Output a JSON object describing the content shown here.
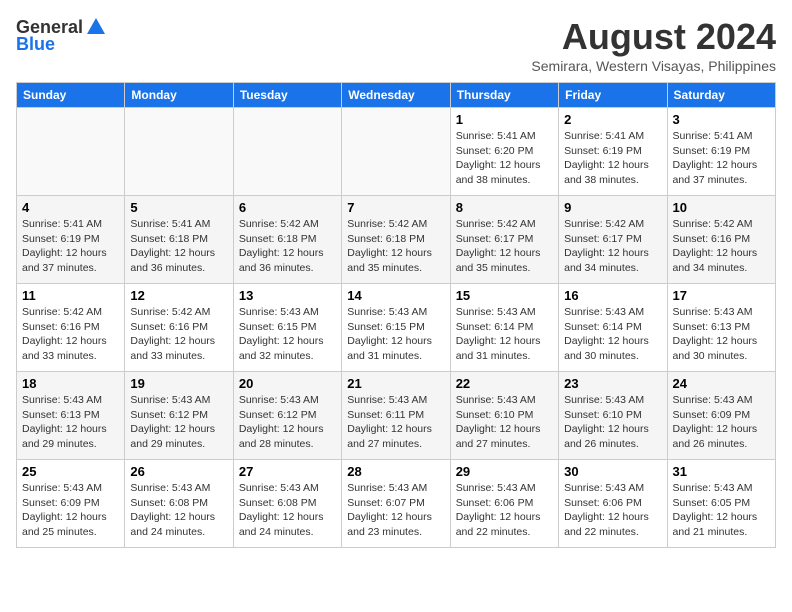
{
  "logo": {
    "general": "General",
    "blue": "Blue"
  },
  "title": {
    "month_year": "August 2024",
    "location": "Semirara, Western Visayas, Philippines"
  },
  "days_of_week": [
    "Sunday",
    "Monday",
    "Tuesday",
    "Wednesday",
    "Thursday",
    "Friday",
    "Saturday"
  ],
  "weeks": [
    [
      {
        "day": "",
        "content": ""
      },
      {
        "day": "",
        "content": ""
      },
      {
        "day": "",
        "content": ""
      },
      {
        "day": "",
        "content": ""
      },
      {
        "day": "1",
        "content": "Sunrise: 5:41 AM\nSunset: 6:20 PM\nDaylight: 12 hours\nand 38 minutes."
      },
      {
        "day": "2",
        "content": "Sunrise: 5:41 AM\nSunset: 6:19 PM\nDaylight: 12 hours\nand 38 minutes."
      },
      {
        "day": "3",
        "content": "Sunrise: 5:41 AM\nSunset: 6:19 PM\nDaylight: 12 hours\nand 37 minutes."
      }
    ],
    [
      {
        "day": "4",
        "content": "Sunrise: 5:41 AM\nSunset: 6:19 PM\nDaylight: 12 hours\nand 37 minutes."
      },
      {
        "day": "5",
        "content": "Sunrise: 5:41 AM\nSunset: 6:18 PM\nDaylight: 12 hours\nand 36 minutes."
      },
      {
        "day": "6",
        "content": "Sunrise: 5:42 AM\nSunset: 6:18 PM\nDaylight: 12 hours\nand 36 minutes."
      },
      {
        "day": "7",
        "content": "Sunrise: 5:42 AM\nSunset: 6:18 PM\nDaylight: 12 hours\nand 35 minutes."
      },
      {
        "day": "8",
        "content": "Sunrise: 5:42 AM\nSunset: 6:17 PM\nDaylight: 12 hours\nand 35 minutes."
      },
      {
        "day": "9",
        "content": "Sunrise: 5:42 AM\nSunset: 6:17 PM\nDaylight: 12 hours\nand 34 minutes."
      },
      {
        "day": "10",
        "content": "Sunrise: 5:42 AM\nSunset: 6:16 PM\nDaylight: 12 hours\nand 34 minutes."
      }
    ],
    [
      {
        "day": "11",
        "content": "Sunrise: 5:42 AM\nSunset: 6:16 PM\nDaylight: 12 hours\nand 33 minutes."
      },
      {
        "day": "12",
        "content": "Sunrise: 5:42 AM\nSunset: 6:16 PM\nDaylight: 12 hours\nand 33 minutes."
      },
      {
        "day": "13",
        "content": "Sunrise: 5:43 AM\nSunset: 6:15 PM\nDaylight: 12 hours\nand 32 minutes."
      },
      {
        "day": "14",
        "content": "Sunrise: 5:43 AM\nSunset: 6:15 PM\nDaylight: 12 hours\nand 31 minutes."
      },
      {
        "day": "15",
        "content": "Sunrise: 5:43 AM\nSunset: 6:14 PM\nDaylight: 12 hours\nand 31 minutes."
      },
      {
        "day": "16",
        "content": "Sunrise: 5:43 AM\nSunset: 6:14 PM\nDaylight: 12 hours\nand 30 minutes."
      },
      {
        "day": "17",
        "content": "Sunrise: 5:43 AM\nSunset: 6:13 PM\nDaylight: 12 hours\nand 30 minutes."
      }
    ],
    [
      {
        "day": "18",
        "content": "Sunrise: 5:43 AM\nSunset: 6:13 PM\nDaylight: 12 hours\nand 29 minutes."
      },
      {
        "day": "19",
        "content": "Sunrise: 5:43 AM\nSunset: 6:12 PM\nDaylight: 12 hours\nand 29 minutes."
      },
      {
        "day": "20",
        "content": "Sunrise: 5:43 AM\nSunset: 6:12 PM\nDaylight: 12 hours\nand 28 minutes."
      },
      {
        "day": "21",
        "content": "Sunrise: 5:43 AM\nSunset: 6:11 PM\nDaylight: 12 hours\nand 27 minutes."
      },
      {
        "day": "22",
        "content": "Sunrise: 5:43 AM\nSunset: 6:10 PM\nDaylight: 12 hours\nand 27 minutes."
      },
      {
        "day": "23",
        "content": "Sunrise: 5:43 AM\nSunset: 6:10 PM\nDaylight: 12 hours\nand 26 minutes."
      },
      {
        "day": "24",
        "content": "Sunrise: 5:43 AM\nSunset: 6:09 PM\nDaylight: 12 hours\nand 26 minutes."
      }
    ],
    [
      {
        "day": "25",
        "content": "Sunrise: 5:43 AM\nSunset: 6:09 PM\nDaylight: 12 hours\nand 25 minutes."
      },
      {
        "day": "26",
        "content": "Sunrise: 5:43 AM\nSunset: 6:08 PM\nDaylight: 12 hours\nand 24 minutes."
      },
      {
        "day": "27",
        "content": "Sunrise: 5:43 AM\nSunset: 6:08 PM\nDaylight: 12 hours\nand 24 minutes."
      },
      {
        "day": "28",
        "content": "Sunrise: 5:43 AM\nSunset: 6:07 PM\nDaylight: 12 hours\nand 23 minutes."
      },
      {
        "day": "29",
        "content": "Sunrise: 5:43 AM\nSunset: 6:06 PM\nDaylight: 12 hours\nand 22 minutes."
      },
      {
        "day": "30",
        "content": "Sunrise: 5:43 AM\nSunset: 6:06 PM\nDaylight: 12 hours\nand 22 minutes."
      },
      {
        "day": "31",
        "content": "Sunrise: 5:43 AM\nSunset: 6:05 PM\nDaylight: 12 hours\nand 21 minutes."
      }
    ]
  ]
}
